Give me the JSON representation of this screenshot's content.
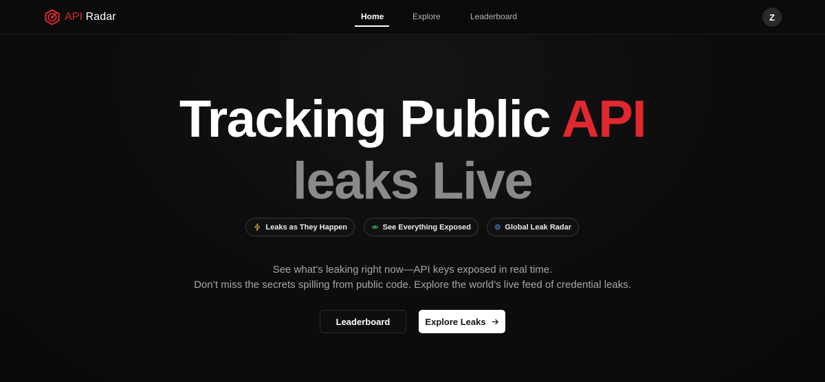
{
  "brand": {
    "accent": "API",
    "name": "Radar",
    "accent_color": "#e0282e",
    "logo_icon": "target-icon"
  },
  "nav": {
    "items": [
      {
        "label": "Home",
        "active": true
      },
      {
        "label": "Explore",
        "active": false
      },
      {
        "label": "Leaderboard",
        "active": false
      }
    ]
  },
  "user": {
    "initial": "Z"
  },
  "hero": {
    "headline_line1_main": "Tracking Public ",
    "headline_line1_accent": "API",
    "headline_line2": "leaks Live",
    "pills": [
      {
        "label": "Leaks as They Happen",
        "icon": "lightning-icon",
        "color": "#e0a53a"
      },
      {
        "label": "See Everything Exposed",
        "icon": "eye-icon",
        "color": "#3fbf5f"
      },
      {
        "label": "Global Leak Radar",
        "icon": "globe-icon",
        "color": "#4f8fe8"
      }
    ],
    "subtext_line1": "See what’s leaking right now—API keys exposed in real time.",
    "subtext_line2": "Don’t miss the secrets spilling from public code. Explore the world’s live feed of credential leaks.",
    "primary_button": "Leaderboard",
    "secondary_button": "Explore Leaks",
    "secondary_button_icon": "arrow-right-icon"
  }
}
